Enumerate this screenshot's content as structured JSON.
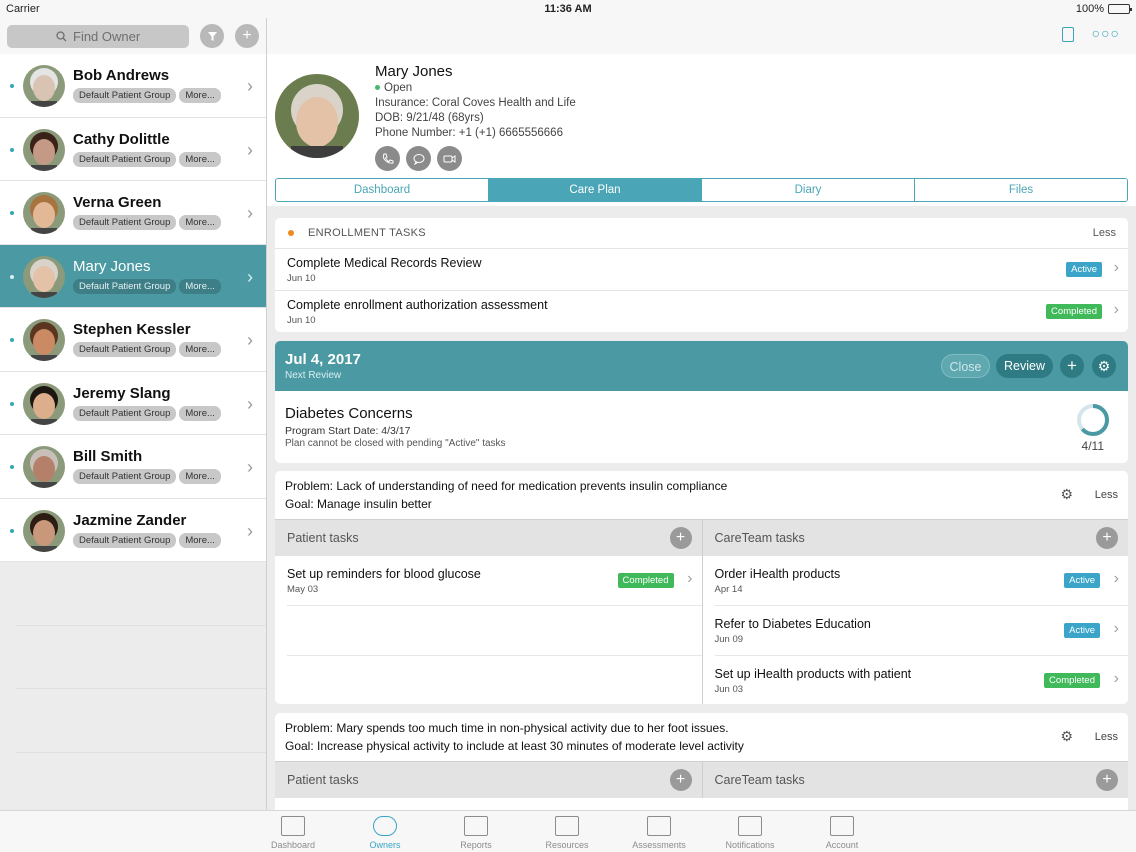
{
  "status_bar": {
    "carrier": "Carrier",
    "time": "11:36 AM",
    "battery": "100%"
  },
  "left": {
    "search_placeholder": "Find Owner",
    "owners": [
      {
        "name": "Bob Andrews",
        "group": "Default Patient Group",
        "more": "More...",
        "selected": false,
        "skin": "#d9c3b3",
        "hair": "#e4e4e4"
      },
      {
        "name": "Cathy Dolittle",
        "group": "Default Patient Group",
        "more": "More...",
        "selected": false,
        "skin": "#c49a86",
        "hair": "#3b2219"
      },
      {
        "name": "Verna Green",
        "group": "Default Patient Group",
        "more": "More...",
        "selected": false,
        "skin": "#e2b896",
        "hair": "#a7733f"
      },
      {
        "name": "Mary Jones",
        "group": "Default Patient Group",
        "more": "More...",
        "selected": true,
        "skin": "#e3c2a8",
        "hair": "#d9d3c9"
      },
      {
        "name": "Stephen Kessler",
        "group": "Default Patient Group",
        "more": "More...",
        "selected": false,
        "skin": "#c98a64",
        "hair": "#5a3520"
      },
      {
        "name": "Jeremy Slang",
        "group": "Default Patient Group",
        "more": "More...",
        "selected": false,
        "skin": "#dcae8c",
        "hair": "#1d1712"
      },
      {
        "name": "Bill Smith",
        "group": "Default Patient Group",
        "more": "More...",
        "selected": false,
        "skin": "#b58069",
        "hair": "#c8c0b8"
      },
      {
        "name": "Jazmine Zander",
        "group": "Default Patient Group",
        "more": "More...",
        "selected": false,
        "skin": "#c9977a",
        "hair": "#2c1c14"
      }
    ]
  },
  "patient": {
    "name": "Mary Jones",
    "status": "Open",
    "insurance": "Insurance: Coral Coves Health and Life",
    "dob": "DOB: 9/21/48 (68yrs)",
    "phone": "Phone Number: +1 (+1) 6665556666"
  },
  "tabs": [
    "Dashboard",
    "Care Plan",
    "Diary",
    "Files"
  ],
  "enrollment": {
    "title": "ENROLLMENT TASKS",
    "less": "Less",
    "tasks": [
      {
        "title": "Complete Medical Records Review",
        "date": "Jun 10",
        "status": "Active"
      },
      {
        "title": "Complete enrollment authorization assessment",
        "date": "Jun 10",
        "status": "Completed"
      }
    ]
  },
  "review": {
    "date": "Jul 4, 2017",
    "sub": "Next Review",
    "close": "Close",
    "review": "Review",
    "plus": "+",
    "gear": "⚙"
  },
  "plan": {
    "title": "Diabetes Concerns",
    "start": "Program Start Date: 4/3/17",
    "note": "Plan cannot be closed with pending \"Active\" tasks",
    "progress": "4/11",
    "done": 4,
    "total": 11
  },
  "problems": [
    {
      "problem": "Problem: Lack of understanding of need for medication prevents insulin compliance",
      "goal": "Goal: Manage insulin better",
      "less": "Less",
      "patient_label": "Patient tasks",
      "careteam_label": "CareTeam tasks",
      "patient_tasks": [
        {
          "title": "Set up reminders for blood glucose",
          "date": "May 03",
          "status": "Completed"
        }
      ],
      "careteam_tasks": [
        {
          "title": "Order iHealth products",
          "date": "Apr 14",
          "status": "Active"
        },
        {
          "title": "Refer to Diabetes Education",
          "date": "Jun 09",
          "status": "Active"
        },
        {
          "title": "Set up iHealth products with patient",
          "date": "Jun 03",
          "status": "Completed"
        }
      ]
    },
    {
      "problem": "Problem: Mary spends too much time in non-physical activity due to her foot issues.",
      "goal": "Goal: Increase physical activity to include at least 30 minutes of moderate level activity",
      "less": "Less",
      "patient_label": "Patient tasks",
      "careteam_label": "CareTeam tasks"
    }
  ],
  "tabbar": [
    "Dashboard",
    "Owners",
    "Reports",
    "Resources",
    "Assessments",
    "Notifications",
    "Account"
  ],
  "colors": {
    "teal": "#4b9aa3",
    "accent": "#3aa5c8",
    "completed": "#3fb95a",
    "active": "#3aa5c8"
  }
}
